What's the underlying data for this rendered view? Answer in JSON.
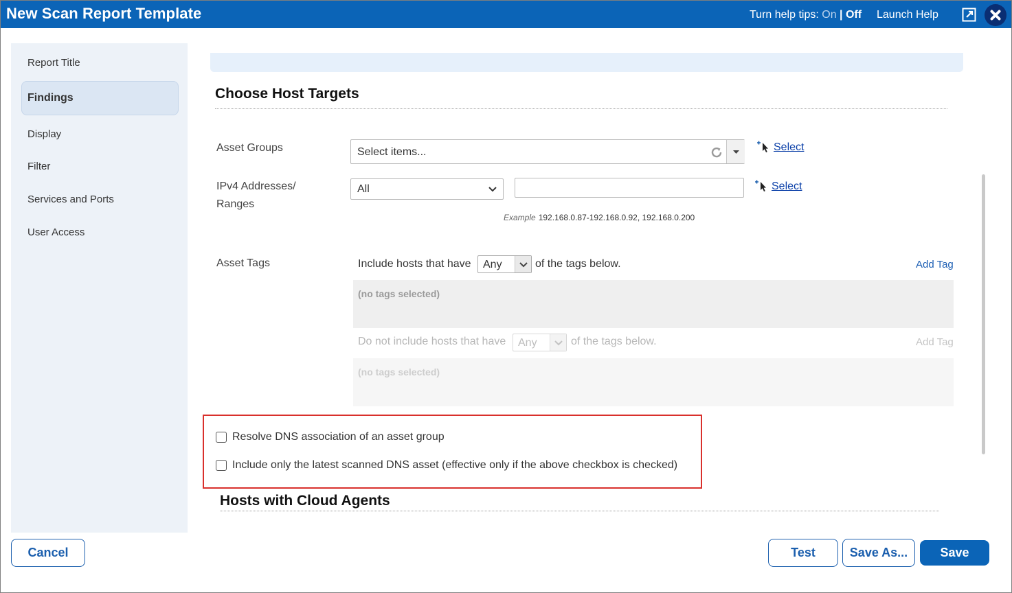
{
  "window": {
    "title": "New Scan Report Template",
    "help_tips": {
      "prefix": "Turn help tips:",
      "on": "On",
      "separator": "|",
      "off": "Off"
    },
    "launch_help": "Launch Help",
    "popout_icon": "popout-icon",
    "close_icon": "close-icon",
    "accent_color": "#0b64b7"
  },
  "sidebar": {
    "items": [
      {
        "label": "Report Title",
        "active": false
      },
      {
        "label": "Findings",
        "active": true
      },
      {
        "label": "Display",
        "active": false
      },
      {
        "label": "Filter",
        "active": false
      },
      {
        "label": "Services and Ports",
        "active": false
      },
      {
        "label": "User Access",
        "active": false
      }
    ]
  },
  "main": {
    "choose_host_targets": {
      "title": "Choose Host Targets",
      "asset_groups": {
        "label": "Asset Groups",
        "placeholder": "Select items...",
        "select_link": "Select"
      },
      "ipv4": {
        "label_line1": "IPv4 Addresses/",
        "label_line2": "Ranges",
        "dropdown_value": "All",
        "input_value": "",
        "select_link": "Select",
        "example_label": "Example",
        "example_value": "192.168.0.87-192.168.0.92, 192.168.0.200"
      },
      "asset_tags": {
        "label": "Asset Tags",
        "include_prefix": "Include hosts that have",
        "include_match": "Any",
        "include_suffix": "of the tags below.",
        "add_tag": "Add Tag",
        "include_empty": "(no tags selected)",
        "exclude_prefix": "Do not include hosts that have",
        "exclude_match": "Any",
        "exclude_suffix": "of the tags below.",
        "exclude_add_tag": "Add Tag",
        "exclude_empty": "(no tags selected)"
      },
      "checkboxes": [
        {
          "label": "Resolve DNS association of an asset group",
          "checked": false
        },
        {
          "label": "Include only the latest scanned DNS asset (effective only if the above checkbox is checked)",
          "checked": false
        }
      ]
    },
    "cloud_agents": {
      "title": "Hosts with Cloud Agents"
    }
  },
  "footer": {
    "cancel": "Cancel",
    "test": "Test",
    "save_as": "Save As...",
    "save": "Save"
  }
}
